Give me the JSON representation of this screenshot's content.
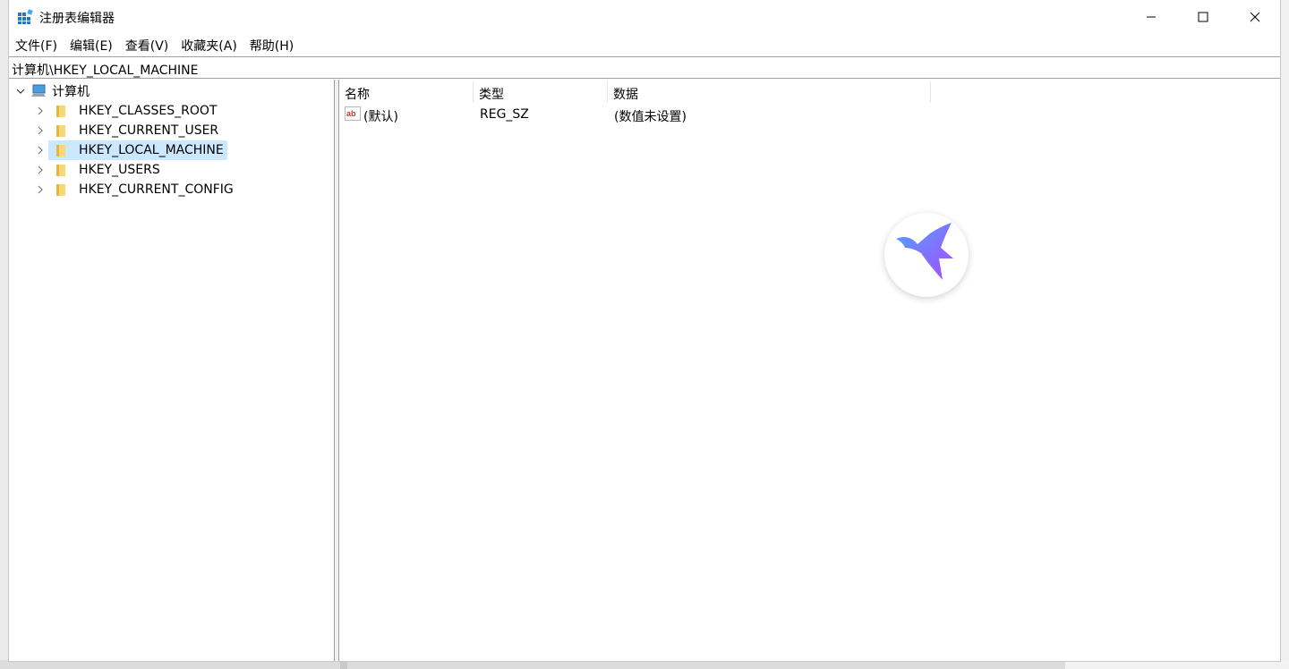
{
  "window": {
    "title": "注册表编辑器"
  },
  "menu": {
    "items": [
      {
        "label": "文件(F)"
      },
      {
        "label": "编辑(E)"
      },
      {
        "label": "查看(V)"
      },
      {
        "label": "收藏夹(A)"
      },
      {
        "label": "帮助(H)"
      }
    ]
  },
  "address": {
    "path": "计算机\\HKEY_LOCAL_MACHINE"
  },
  "tree": {
    "root": {
      "label": "计算机",
      "icon": "computer-icon",
      "expanded": true
    },
    "children": [
      {
        "label": "HKEY_CLASSES_ROOT",
        "selected": false
      },
      {
        "label": "HKEY_CURRENT_USER",
        "selected": false
      },
      {
        "label": "HKEY_LOCAL_MACHINE",
        "selected": true
      },
      {
        "label": "HKEY_USERS",
        "selected": false
      },
      {
        "label": "HKEY_CURRENT_CONFIG",
        "selected": false
      }
    ]
  },
  "list": {
    "columns": {
      "name": "名称",
      "type": "类型",
      "data": "数据"
    },
    "rows": [
      {
        "name": "(默认)",
        "type": "REG_SZ",
        "data": "(数值未设置)",
        "icon": "string-value-icon"
      }
    ]
  },
  "colors": {
    "selection": "#cce8ff",
    "border": "#a0a0a0",
    "folder": "#f8d775"
  }
}
